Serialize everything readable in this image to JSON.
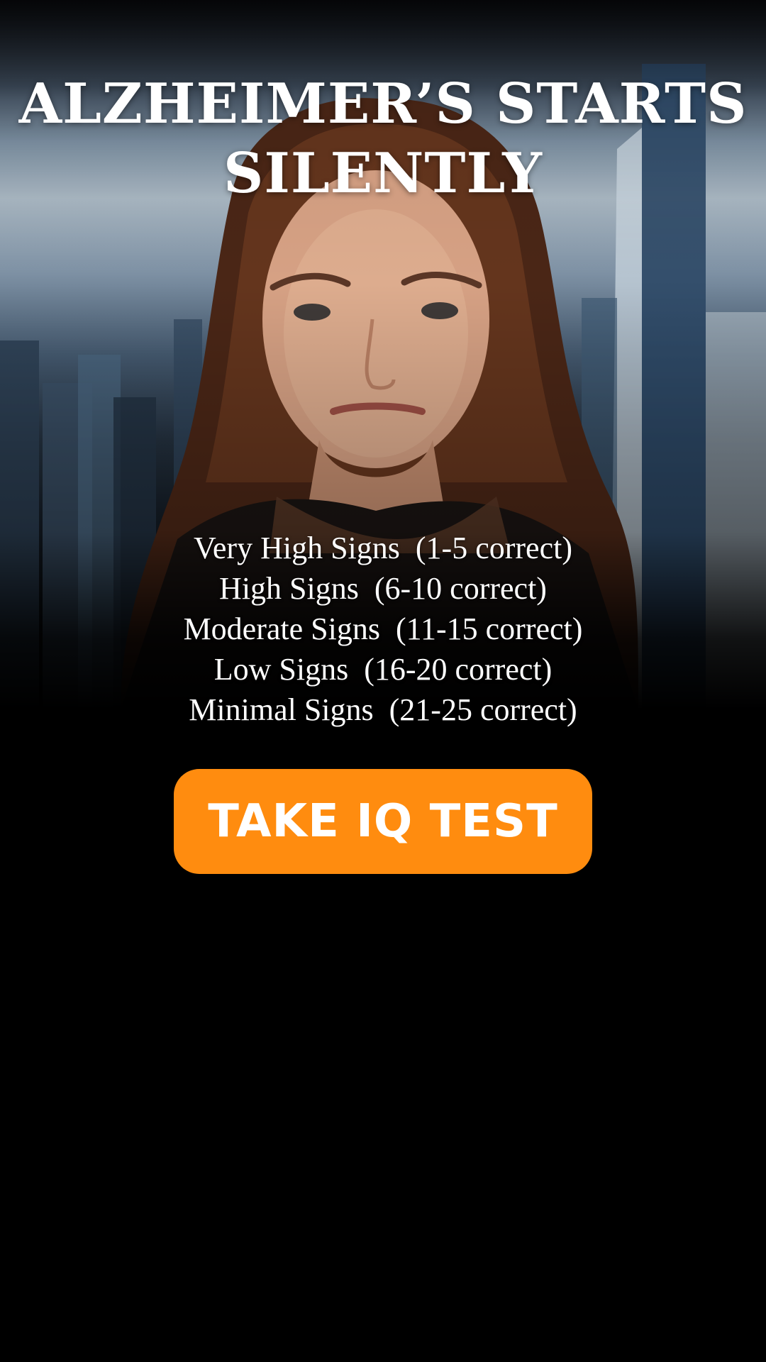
{
  "headline": {
    "line1": "ALZHEIMER’S STARTS",
    "line2": "SILENTLY"
  },
  "hero_image": {
    "description_icon": "portrait-photo"
  },
  "score_levels": [
    {
      "label": "Very High Signs  (1-5 correct)"
    },
    {
      "label": "High Signs  (6-10 correct)"
    },
    {
      "label": "Moderate Signs  (11-15 correct)"
    },
    {
      "label": "Low Signs  (16-20 correct)"
    },
    {
      "label": "Minimal Signs  (21-25 correct)"
    }
  ],
  "cta": {
    "label": "TAKE IQ TEST"
  },
  "colors": {
    "background": "#000000",
    "accent": "#ff8c0f",
    "text": "#ffffff"
  }
}
